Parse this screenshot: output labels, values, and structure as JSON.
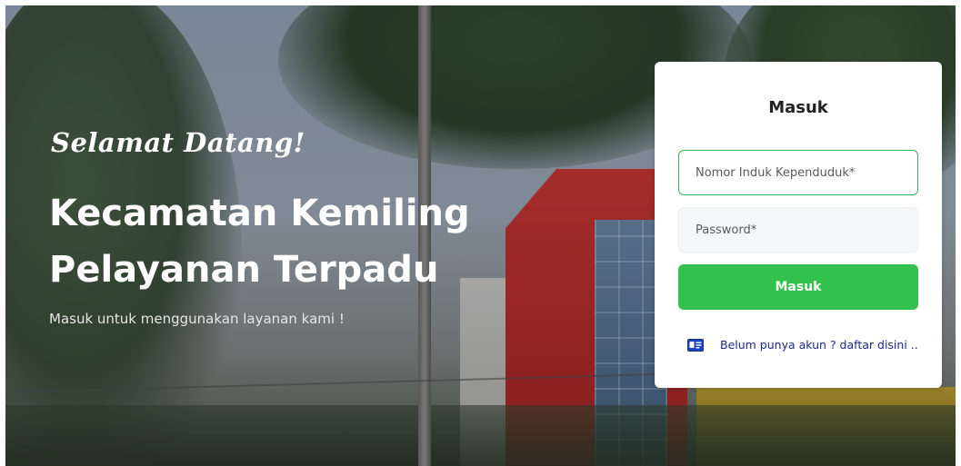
{
  "hero": {
    "welcome": "Selamat Datang!",
    "title_line1": "Kecamatan Kemiling",
    "title_line2": "Pelayanan Terpadu",
    "subtitle": "Masuk untuk menggunakan layanan kami !"
  },
  "login": {
    "heading": "Masuk",
    "nik_placeholder": "Nomor Induk Kependuduk*",
    "nik_value": "",
    "password_placeholder": "Password*",
    "password_value": "",
    "submit_label": "Masuk",
    "register_icon": "id-card-icon",
    "register_text": "Belum punya akun ? daftar disini .."
  },
  "colors": {
    "accent": "#32c14c",
    "link": "#1b2a8f",
    "focus_border": "#3ab85b"
  }
}
